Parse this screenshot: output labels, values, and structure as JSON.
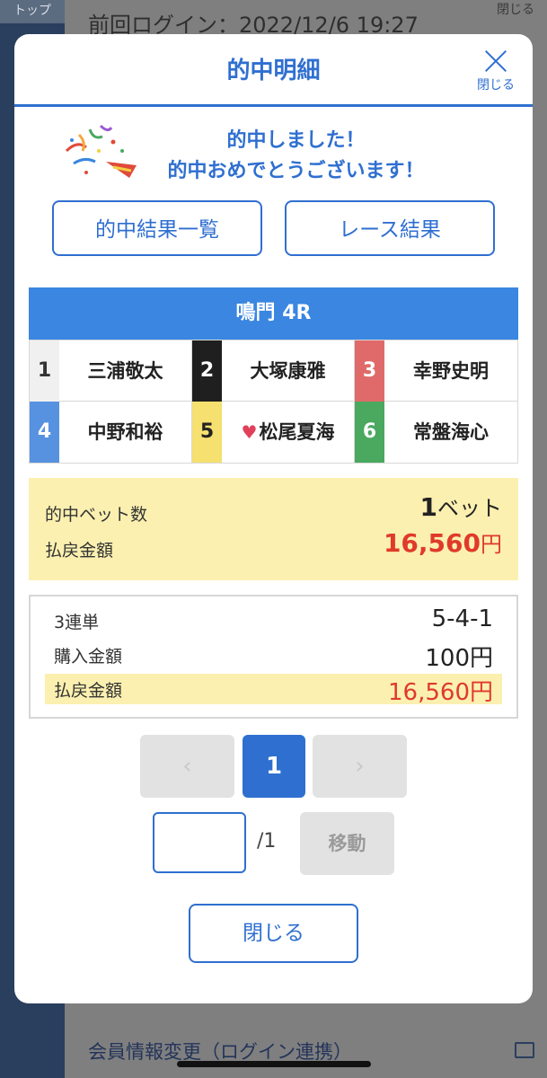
{
  "background": {
    "tab_label": "トップ",
    "last_login": "前回ログイン：2022/12/6 19:27",
    "close_label": "閉じる",
    "bottom_link": "会員情報変更（ログイン連携）"
  },
  "modal": {
    "title": "的中明細",
    "close_label": "閉じる",
    "congrats_line1": "的中しました！",
    "congrats_line2": "的中おめでとうございます！",
    "btn_results_list": "的中結果一覧",
    "btn_race_results": "レース結果",
    "race_title": "鳴門 4R",
    "racers": [
      {
        "num": "1",
        "name": "三浦敬太",
        "favorite": false
      },
      {
        "num": "2",
        "name": "大塚康雅",
        "favorite": false
      },
      {
        "num": "3",
        "name": "幸野史明",
        "favorite": false
      },
      {
        "num": "4",
        "name": "中野和裕",
        "favorite": false
      },
      {
        "num": "5",
        "name": "松尾夏海",
        "favorite": true
      },
      {
        "num": "6",
        "name": "常盤海心",
        "favorite": false
      }
    ],
    "summary": {
      "bets_label": "的中ベット数",
      "bets_value": "1",
      "bets_unit": "ベット",
      "payout_label": "払戻金額",
      "payout_value": "16,560",
      "payout_unit": "円"
    },
    "detail": {
      "type_label": "3連単",
      "type_value": "5-4-1",
      "purchase_label": "購入金額",
      "purchase_value": "100円",
      "payout_label": "払戻金額",
      "payout_value": "16,560円"
    },
    "pagination": {
      "prev": "‹",
      "current": "1",
      "next": "›",
      "input_value": "",
      "total": "/1",
      "move_label": "移動"
    },
    "close_button": "閉じる"
  },
  "colors": {
    "accent": "#2f6fd0",
    "highlight": "#fbf0b0",
    "payout_red": "#e03a2a"
  }
}
